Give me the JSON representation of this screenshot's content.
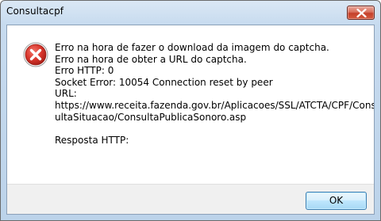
{
  "window": {
    "title": "Consultacpf",
    "close_icon": "close-icon"
  },
  "dialog": {
    "icon": "error-icon",
    "message_lines": [
      "Erro na hora de fazer o download da imagem do captcha.",
      "Erro na hora de obter a URL do captcha.",
      "Erro HTTP: 0",
      "Socket Error: 10054 Connection reset by peer",
      "URL:",
      "https://www.receita.fazenda.gov.br/Aplicacoes/SSL/ATCTA/CPF/Cons",
      "ultaSituacao/ConsultaPublicaSonoro.asp",
      "",
      "Resposta HTTP:"
    ],
    "ok_label": "OK"
  },
  "colors": {
    "error_red": "#c8322b",
    "close_button_red": "#c5412b",
    "button_border": "#3c7fb1"
  }
}
